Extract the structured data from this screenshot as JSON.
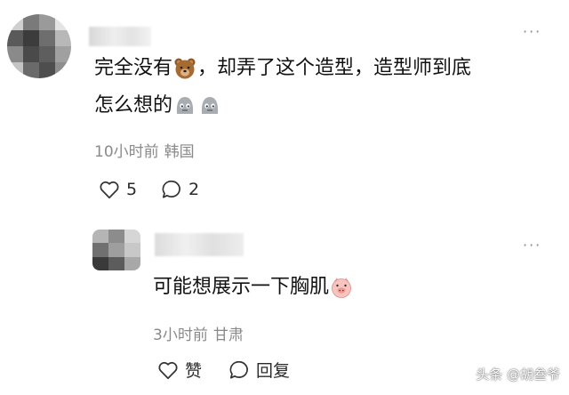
{
  "comments": [
    {
      "avatar_icon": "pixelated-avatar",
      "text_part1": "完全没有",
      "emoji_1": "bear-face",
      "text_part2": "，却弄了这个造型，造型师到底",
      "text_line2": "怎么想的",
      "emoji_2": "hmm-face",
      "emoji_3": "hmm-face",
      "time": "10小时前",
      "location": "韩国",
      "like_icon": "heart-outline-icon",
      "like_count": "5",
      "reply_icon": "comment-bubble-icon",
      "reply_count": "2"
    },
    {
      "avatar_icon": "pixelated-avatar",
      "text": "可能想展示一下胸肌",
      "emoji": "pig-face",
      "time": "3小时前",
      "location": "甘肃",
      "like_icon": "heart-outline-icon",
      "like_label": "赞",
      "reply_icon": "comment-bubble-icon",
      "reply_label": "回复"
    }
  ],
  "more_icon": "ellipsis-icon",
  "watermark": "头条 @胡叁爷"
}
